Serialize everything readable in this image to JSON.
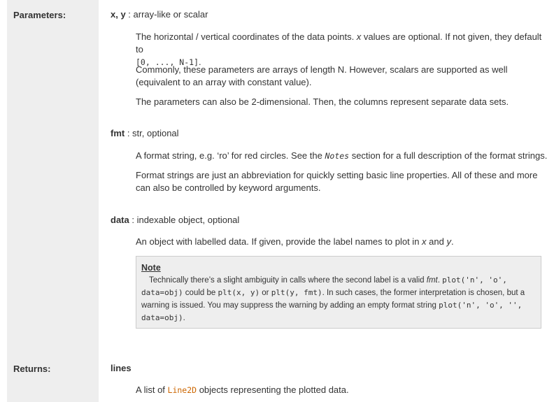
{
  "parameters": {
    "label": "Parameters:",
    "xy": {
      "name": "x, y",
      "type": " : array-like or scalar",
      "p1_a": "The horizontal / vertical coordinates of the data points. ",
      "p1_x": "x",
      "p1_b": " values are optional. If not given, they default to",
      "p1_code": "[0, ..., N-1]",
      "p1_end": ".",
      "p2_line1": "Commonly, these parameters are arrays of length N. However, scalars are supported as well",
      "p2_line2": "(equivalent to an array with constant value).",
      "p3": "The parameters can also be 2-dimensional. Then, the columns represent separate data sets."
    },
    "fmt": {
      "name": "fmt",
      "type": " : str, optional",
      "p1_a": "A format string, e.g. ‘ro’ for red circles. See the ",
      "p1_notes": "Notes",
      "p1_b": " section for a full description of the format strings.",
      "p2_line1": "Format strings are just an abbreviation for quickly setting basic line properties. All of these and more",
      "p2_line2": "can also be controlled by keyword arguments."
    },
    "data": {
      "name": "data",
      "type": " : indexable object, optional",
      "p1_a": "An object with labelled data. If given, provide the label names to plot in ",
      "p1_x": "x",
      "p1_and": " and ",
      "p1_y": "y",
      "p1_end": "."
    }
  },
  "note": {
    "title": "Note",
    "l1_a": "Technically there’s a slight ambiguity in calls where the second label is a valid ",
    "l1_fmt": "fmt",
    "l1_sep": ". ",
    "l1_code": "plot('n', 'o',",
    "l2_code1": "data=obj)",
    "l2_a": " could be ",
    "l2_code2": "plt(x, y)",
    "l2_b": " or ",
    "l2_code3": "plt(y, fmt)",
    "l2_c": ". In such cases, the former interpretation is chosen, but a",
    "l3_a": "warning is issued. You may suppress the warning by adding an empty format string ",
    "l3_code": "plot('n', 'o', '',",
    "l4_code": "data=obj)",
    "l4_end": "."
  },
  "returns": {
    "label": "Returns:",
    "name": "lines",
    "desc_a": "A list of ",
    "desc_link": "Line2D",
    "desc_b": " objects representing the plotted data."
  },
  "colors": {
    "field_bg": "#eeeeee",
    "link": "#cc6600"
  }
}
